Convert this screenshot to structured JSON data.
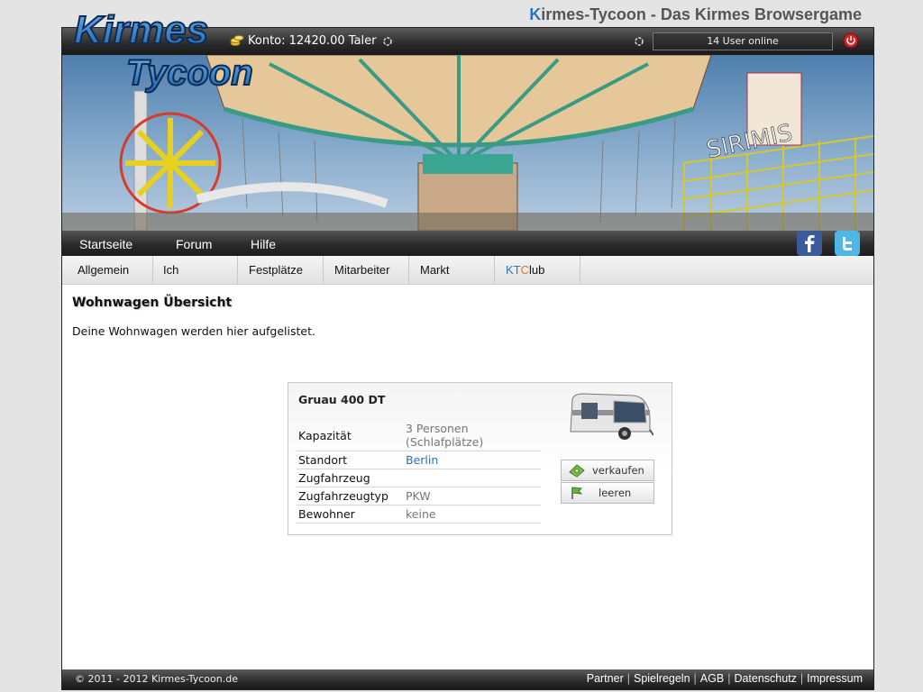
{
  "site": {
    "logo_line1": "Kirmes",
    "logo_line2": "Tycoon",
    "title_first": "K",
    "title_rest": "irmes-Tycoon - Das Kirmes Browsergame"
  },
  "topbar": {
    "konto": "Konto: 12420.00 Taler",
    "users_online": "14 User online"
  },
  "mainnav": [
    {
      "label": "Startseite"
    },
    {
      "label": "Forum"
    },
    {
      "label": "Hilfe"
    }
  ],
  "subnav": [
    {
      "label": "Allgemein"
    },
    {
      "label": "Ich"
    },
    {
      "label": "Festplätze"
    },
    {
      "label": "Mitarbeiter"
    },
    {
      "label": "Markt"
    }
  ],
  "ktclub": {
    "kt_k": "KT",
    "kt_c": "C",
    "kt_rest": "lub"
  },
  "page": {
    "heading": "Wohnwagen Übersicht",
    "intro": "Deine Wohnwagen werden hier aufgelistet."
  },
  "caravan": {
    "name": "Gruau 400 DT",
    "rows": [
      {
        "label": "Kapazität",
        "value": "3 Personen (Schlafplätze)"
      },
      {
        "label": "Standort",
        "value": "Berlin"
      },
      {
        "label": "Zugfahrzeug",
        "value": ""
      },
      {
        "label": "Zugfahrzeugtyp",
        "value": "PKW"
      },
      {
        "label": "Bewohner",
        "value": "keine"
      }
    ],
    "sell_label": "verkaufen",
    "empty_label": "leeren"
  },
  "footer": {
    "copyright": "© 2011 - 2012 Kirmes-Tycoon.de",
    "links": [
      "Partner",
      "Spielregeln",
      "AGB",
      "Datenschutz",
      "Impressum"
    ]
  },
  "colors": {
    "accent": "#2f73b8",
    "kt_orange": "#e2731e",
    "bar_dark": "#2a2a2a"
  }
}
